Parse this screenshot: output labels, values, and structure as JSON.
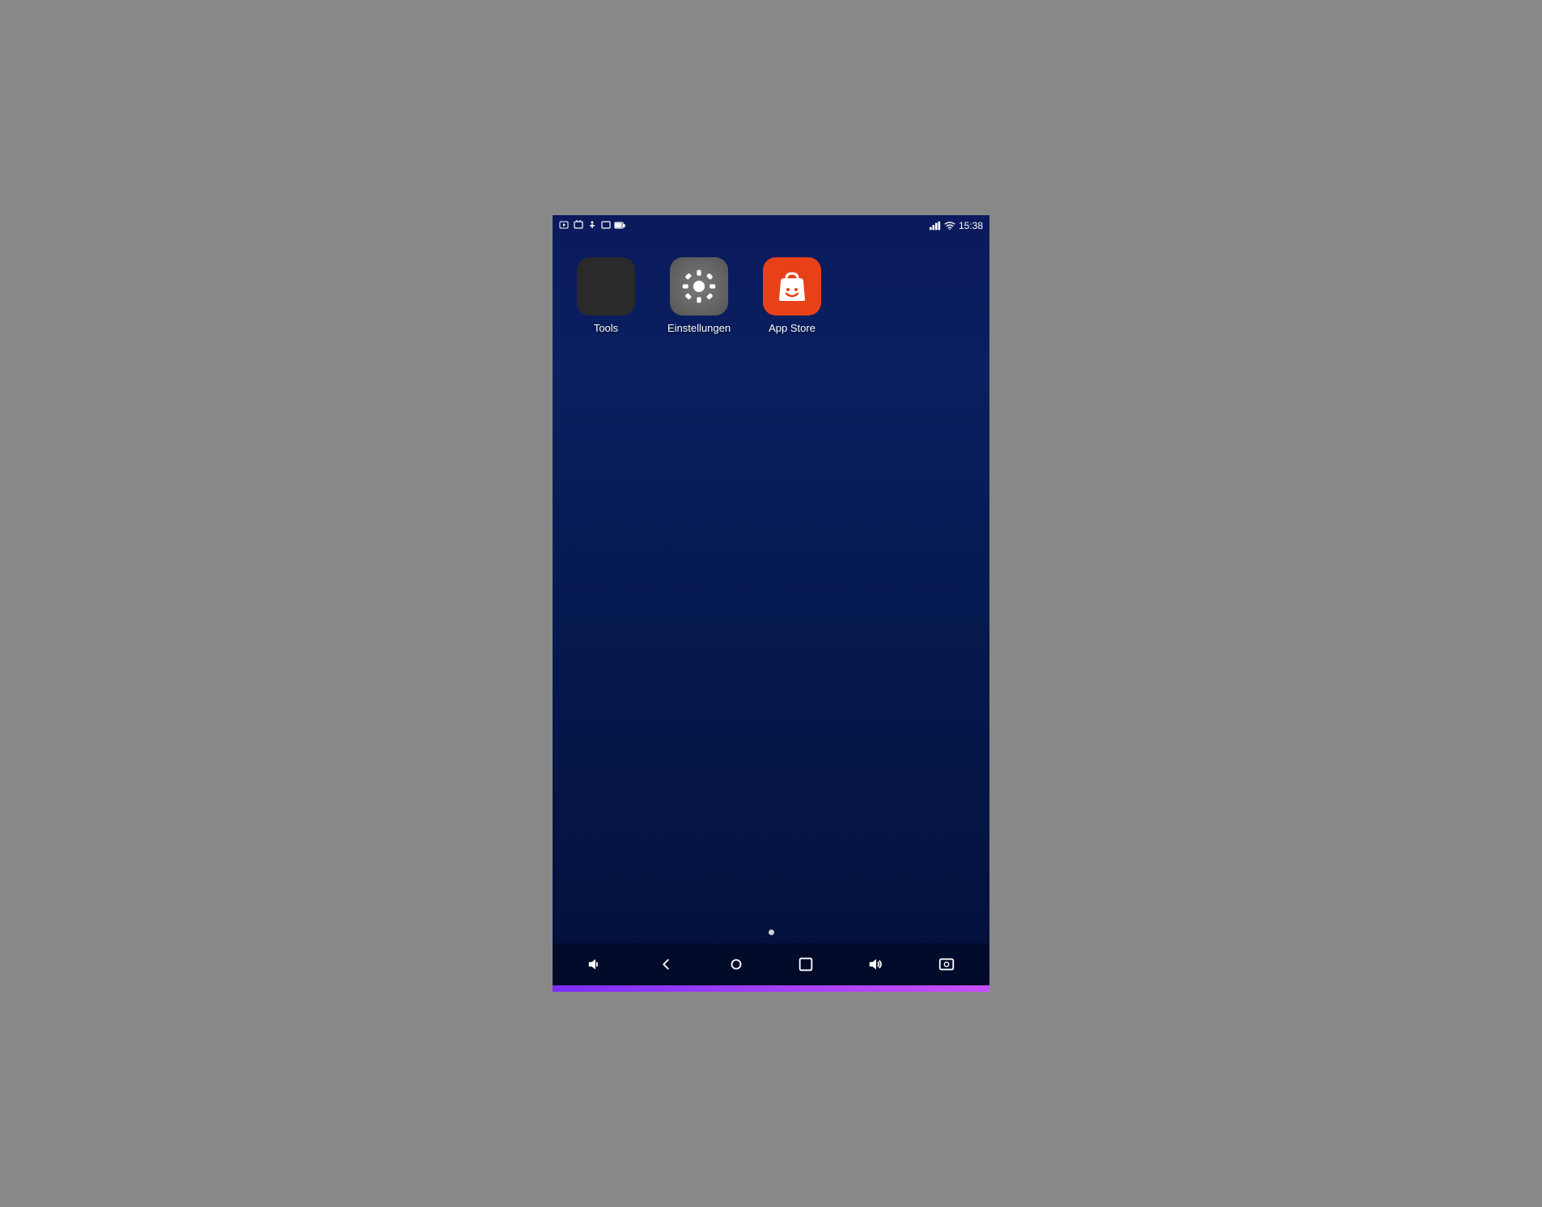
{
  "status_bar": {
    "time": "15:38",
    "icons_left": [
      "screen-record",
      "screenshot",
      "accessibility",
      "notification",
      "battery-saver"
    ],
    "icons_right": [
      "signal",
      "wifi",
      "time"
    ]
  },
  "apps": [
    {
      "id": "tools",
      "label": "Tools",
      "icon_type": "folder",
      "color": "#2a2a2a"
    },
    {
      "id": "settings",
      "label": "Einstellungen",
      "icon_type": "gear",
      "color": "#666666"
    },
    {
      "id": "appstore",
      "label": "App Store",
      "icon_type": "store",
      "color": "#e84118"
    }
  ],
  "page_indicator": {
    "dots": 1,
    "active": 0
  },
  "nav_bar": {
    "buttons": [
      "volume-down",
      "back",
      "home",
      "recent-apps",
      "volume-up",
      "screenshot"
    ]
  },
  "tools_mini_icons": [
    {
      "bg": "#4caf50",
      "color": "white"
    },
    {
      "bg": "#ff9800",
      "color": "white"
    },
    {
      "bg": "#2196f3",
      "color": "white"
    },
    {
      "bg": "#f44336",
      "color": "white"
    },
    {
      "bg": "#ffeb3b",
      "color": "black"
    },
    {
      "bg": "#9c27b0",
      "color": "white"
    },
    {
      "bg": "#00bcd4",
      "color": "white"
    },
    {
      "bg": "#ff5722",
      "color": "white"
    },
    {
      "bg": "#8bc34a",
      "color": "white"
    }
  ]
}
